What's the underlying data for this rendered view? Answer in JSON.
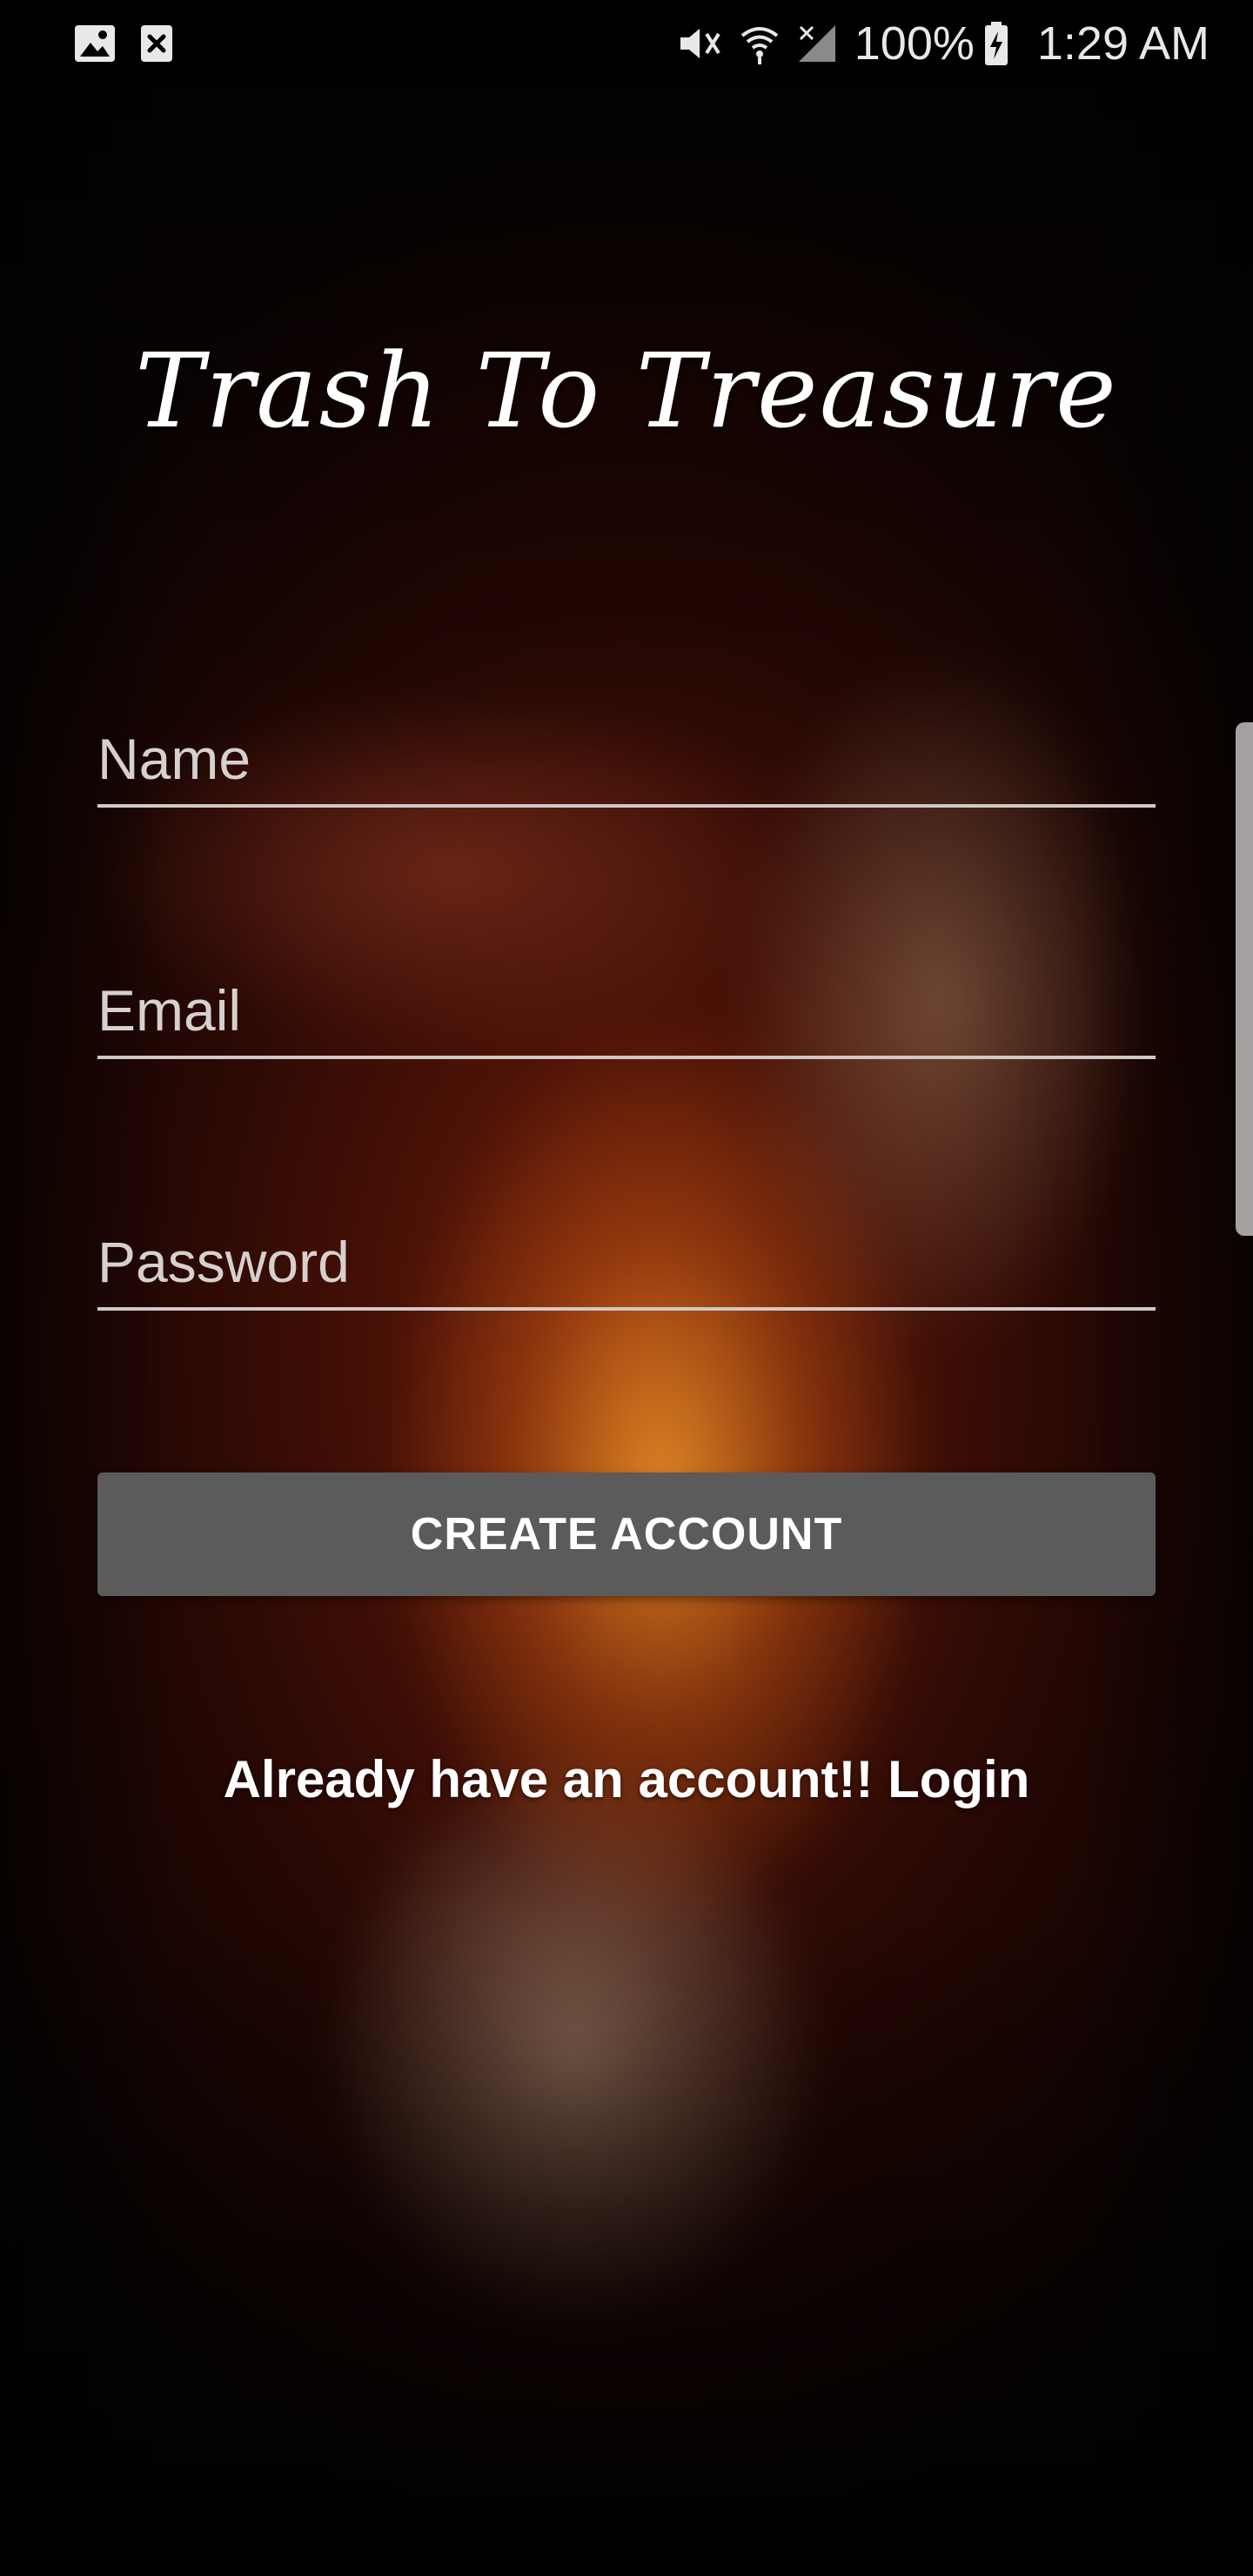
{
  "status_bar": {
    "left_icons": [
      "image-icon",
      "close-box-icon"
    ],
    "right_icons": [
      "mute-vibrate-icon",
      "wifi-icon",
      "signal-icon",
      "battery-charging-icon"
    ],
    "battery": "100%",
    "time": "1:29 AM"
  },
  "app": {
    "title": "Trash To Treasure"
  },
  "form": {
    "name_placeholder": "Name",
    "name_value": "",
    "email_placeholder": "Email",
    "email_value": "",
    "password_placeholder": "Password",
    "password_value": "",
    "create_button_label": "CREATE ACCOUNT",
    "login_link": "Already have an account!! Login"
  },
  "colors": {
    "button_bg": "#5c5b5c",
    "text": "#ffffff",
    "underline": "#cfc8c6"
  }
}
